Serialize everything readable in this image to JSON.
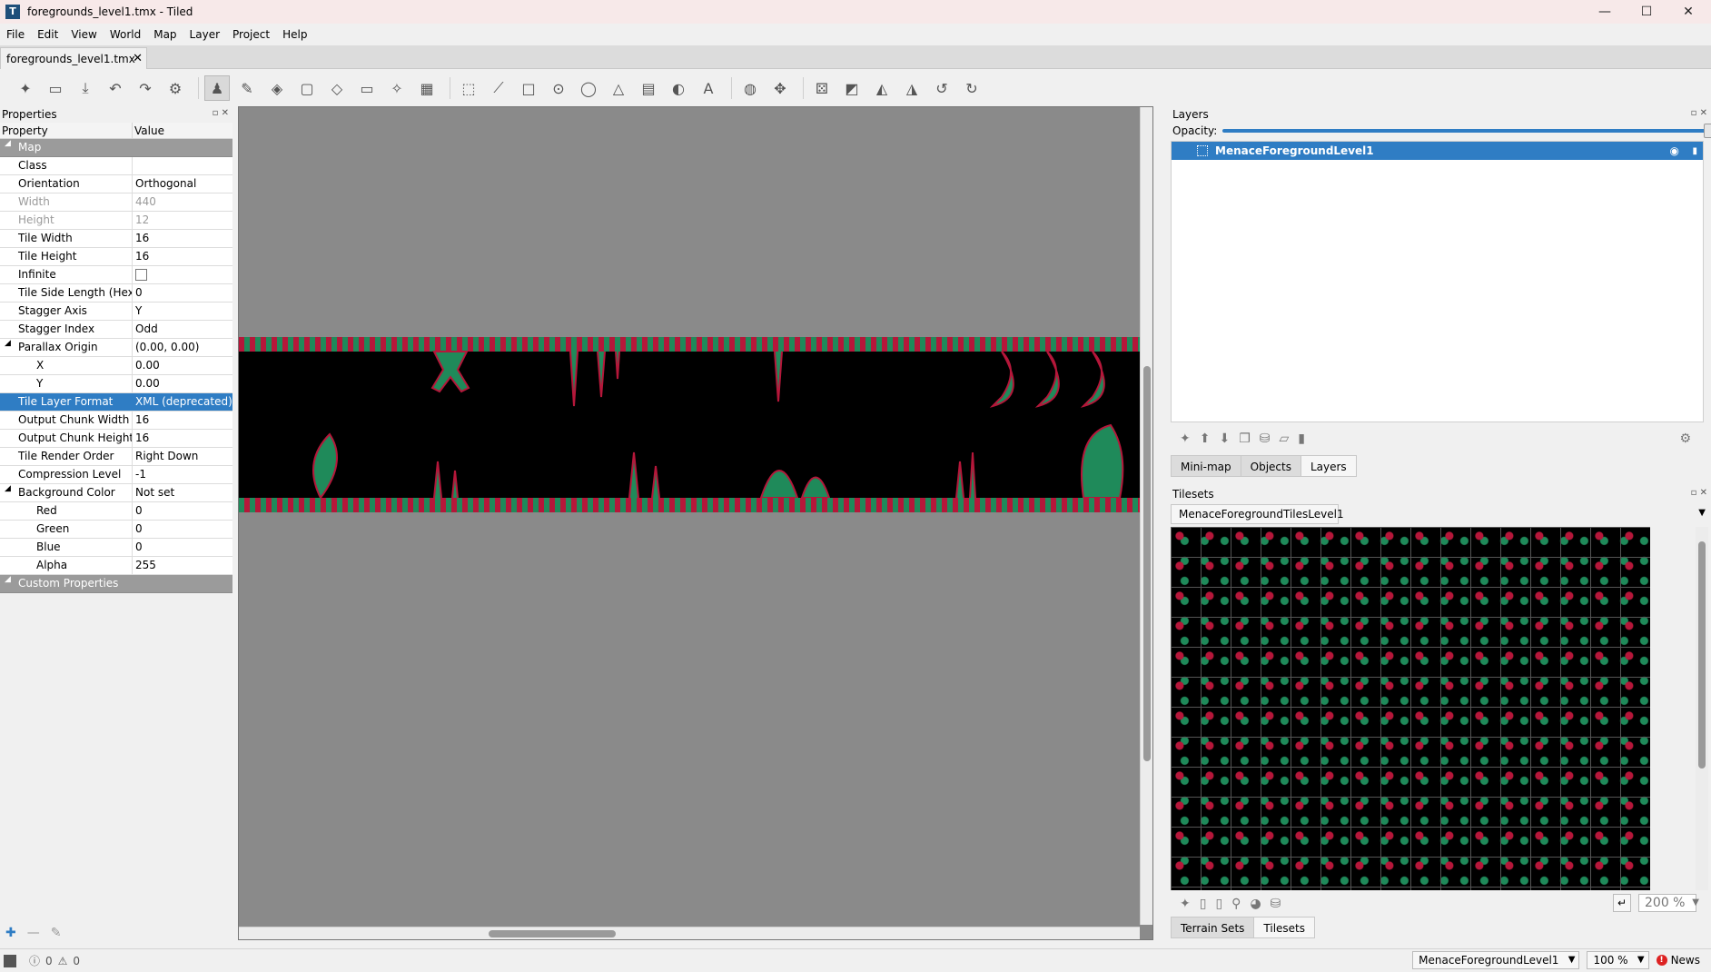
{
  "window": {
    "title": "foregrounds_level1.tmx - Tiled",
    "controls": {
      "minimize": "—",
      "maximize": "☐",
      "close": "✕"
    }
  },
  "menu": [
    "File",
    "Edit",
    "View",
    "World",
    "Map",
    "Layer",
    "Project",
    "Help"
  ],
  "doc_tab": {
    "label": "foregrounds_level1.tmx",
    "close": "✕"
  },
  "properties": {
    "title": "Properties",
    "col_property": "Property",
    "col_value": "Value",
    "rows": {
      "map": "Map",
      "class_k": "Class",
      "class_v": "",
      "orientation_k": "Orientation",
      "orientation_v": "Orthogonal",
      "width_k": "Width",
      "width_v": "440",
      "height_k": "Height",
      "height_v": "12",
      "tile_width_k": "Tile Width",
      "tile_width_v": "16",
      "tile_height_k": "Tile Height",
      "tile_height_v": "16",
      "infinite_k": "Infinite",
      "tile_side_k": "Tile Side Length (Hex)",
      "tile_side_v": "0",
      "stagger_axis_k": "Stagger Axis",
      "stagger_axis_v": "Y",
      "stagger_index_k": "Stagger Index",
      "stagger_index_v": "Odd",
      "parallax_k": "Parallax Origin",
      "parallax_v": "(0.00, 0.00)",
      "x_k": "X",
      "x_v": "0.00",
      "y_k": "Y",
      "y_v": "0.00",
      "tile_layer_format_k": "Tile Layer Format",
      "tile_layer_format_v": "XML (deprecated)",
      "chunk_w_k": "Output Chunk Width",
      "chunk_w_v": "16",
      "chunk_h_k": "Output Chunk Height",
      "chunk_h_v": "16",
      "render_order_k": "Tile Render Order",
      "render_order_v": "Right Down",
      "compression_k": "Compression Level",
      "compression_v": "-1",
      "bg_color_k": "Background Color",
      "bg_color_v": "Not set",
      "red_k": "Red",
      "red_v": "0",
      "green_k": "Green",
      "green_v": "0",
      "blue_k": "Blue",
      "blue_v": "0",
      "alpha_k": "Alpha",
      "alpha_v": "255",
      "custom": "Custom Properties"
    }
  },
  "layers": {
    "title": "Layers",
    "opacity_label": "Opacity:",
    "opacity_value": 1.0,
    "items": [
      "MenaceForegroundLevel1"
    ],
    "tabs": [
      "Mini-map",
      "Objects",
      "Layers"
    ]
  },
  "tilesets": {
    "title": "Tilesets",
    "active_tileset": "MenaceForegroundTilesLevel1",
    "zoom": "200 %",
    "tabs": [
      "Terrain Sets",
      "Tilesets"
    ]
  },
  "status": {
    "errors": "0",
    "warnings": "0",
    "layer_select": "MenaceForegroundLevel1",
    "zoom": "100 %",
    "news": "News"
  },
  "colors": {
    "accent": "#2f7dc4",
    "tile_red": "#b5173a",
    "tile_green": "#1f8a5a",
    "canvas_bg": "#8a8a8a"
  }
}
